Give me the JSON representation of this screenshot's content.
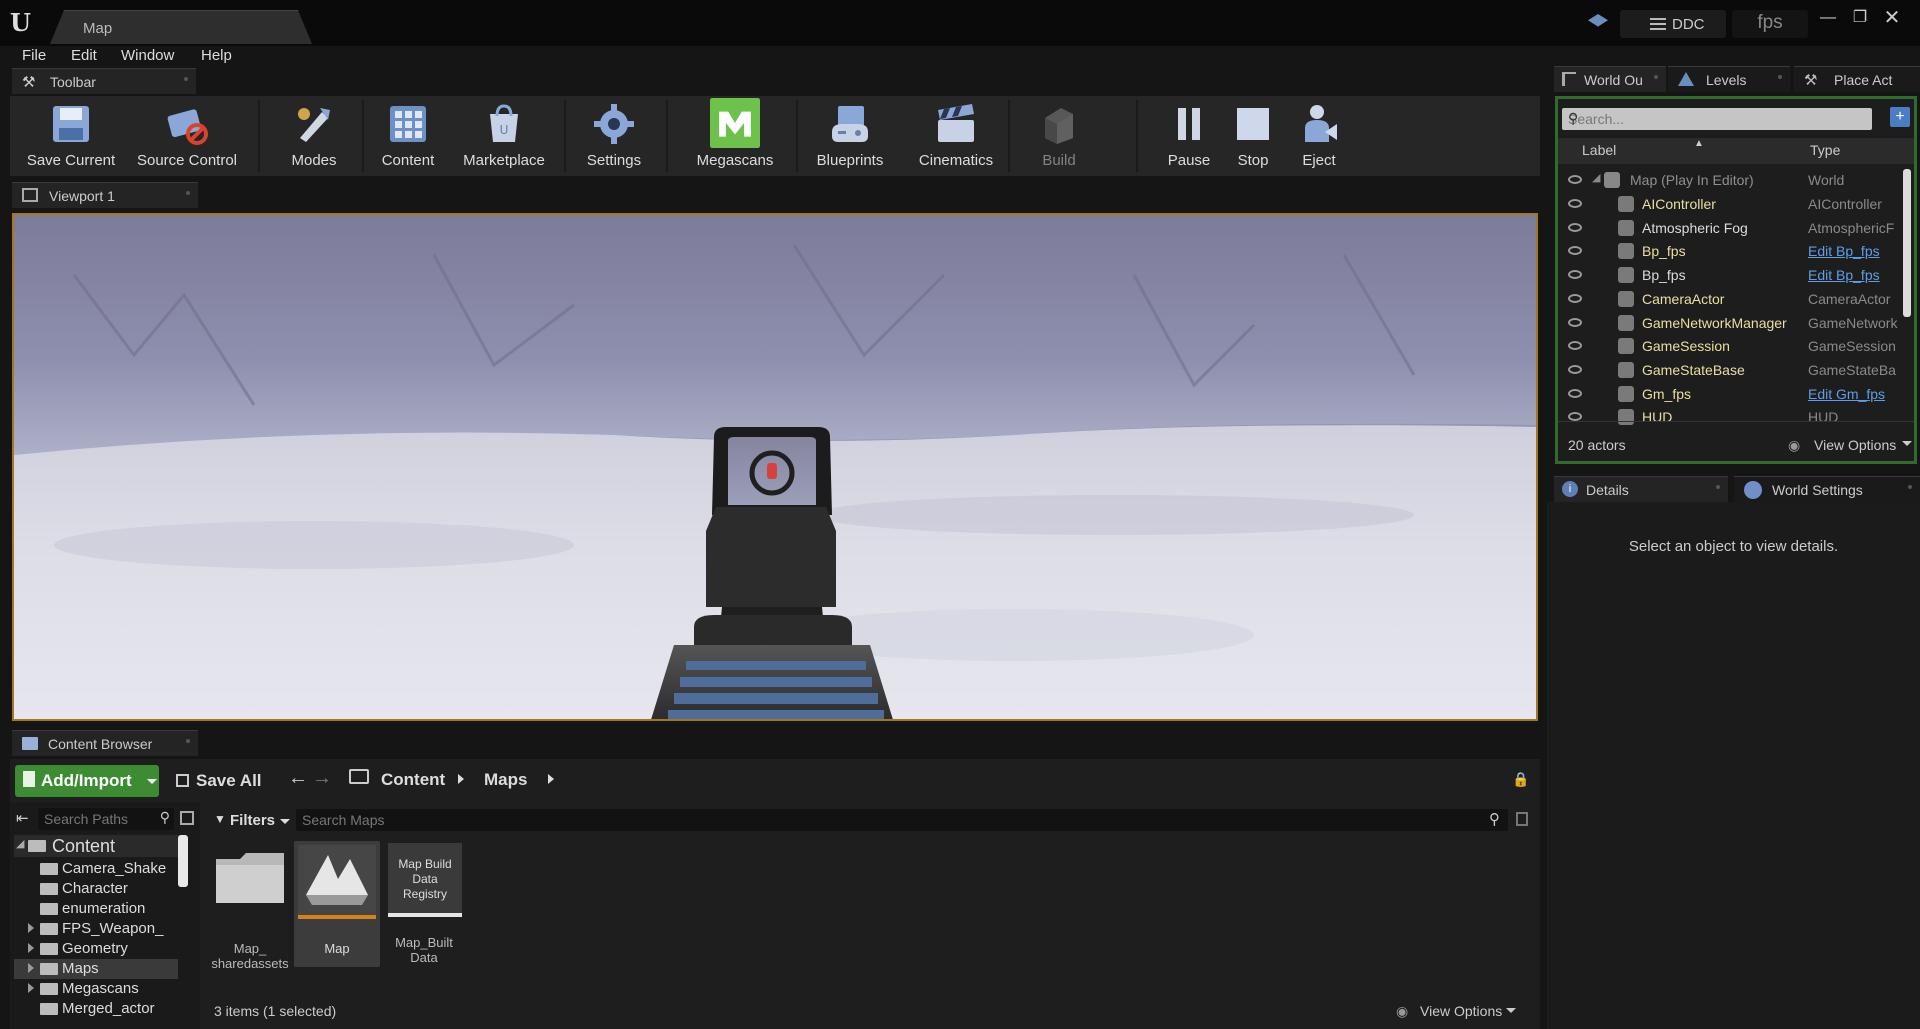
{
  "window": {
    "title": "Map",
    "project": "fps",
    "ddc_label": "DDC"
  },
  "menu": [
    "File",
    "Edit",
    "Window",
    "Help"
  ],
  "toolbar": {
    "tab_label": "Toolbar",
    "buttons": {
      "save_current": "Save Current",
      "source_control": "Source Control",
      "modes": "Modes",
      "content": "Content",
      "marketplace": "Marketplace",
      "settings": "Settings",
      "megascans": "Megascans",
      "blueprints": "Blueprints",
      "cinematics": "Cinematics",
      "build": "Build",
      "pause": "Pause",
      "stop": "Stop",
      "eject": "Eject"
    }
  },
  "viewport": {
    "tab_label": "Viewport 1"
  },
  "outliner": {
    "tabs": [
      "World Ou",
      "Levels",
      "Place Act"
    ],
    "search_placeholder": "Search...",
    "columns": {
      "label": "Label",
      "type": "Type"
    },
    "root": {
      "name": "Map (Play In Editor)",
      "type": "World"
    },
    "rows": [
      {
        "name": "AIController",
        "type": "AIController",
        "link": false
      },
      {
        "name": "Atmospheric Fog",
        "type": "AtmosphericF",
        "link": false
      },
      {
        "name": "Bp_fps",
        "type": "Edit Bp_fps",
        "link": true
      },
      {
        "name": "Bp_fps",
        "type": "Edit Bp_fps",
        "link": true
      },
      {
        "name": "CameraActor",
        "type": "CameraActor",
        "link": false
      },
      {
        "name": "GameNetworkManager",
        "type": "GameNetwork",
        "link": false
      },
      {
        "name": "GameSession",
        "type": "GameSession",
        "link": false
      },
      {
        "name": "GameStateBase",
        "type": "GameStateBa",
        "link": false
      },
      {
        "name": "Gm_fps",
        "type": "Edit Gm_fps",
        "link": true
      },
      {
        "name": "HUD",
        "type": "HUD",
        "link": false
      }
    ],
    "actor_count": "20 actors",
    "view_options": "View Options"
  },
  "details": {
    "tabs": [
      "Details",
      "World Settings"
    ],
    "empty_message": "Select an object to view details."
  },
  "content_browser": {
    "tab_label": "Content Browser",
    "add_import": "Add/Import",
    "save_all": "Save All",
    "breadcrumbs": [
      "Content",
      "Maps"
    ],
    "search_paths_placeholder": "Search Paths",
    "filters_label": "Filters",
    "search_maps_placeholder": "Search Maps",
    "tree": {
      "root": "Content",
      "items": [
        "Camera_Shake",
        "Character",
        "enumeration",
        "FPS_Weapon_",
        "Geometry",
        "Maps",
        "Megascans",
        "Merged_actor"
      ]
    },
    "assets": [
      {
        "label": "Map_\nsharedassets"
      },
      {
        "label": "Map"
      },
      {
        "label": "Map_Built\nData",
        "thumb_text": "Map Build\nData\nRegistry"
      }
    ],
    "status": "3 items (1 selected)",
    "view_options": "View Options"
  },
  "colors": {
    "accent_orange": "#a67722",
    "outliner_border": "#2f6b2a",
    "add_import_green": "#3d8c34",
    "megascans_green": "#6cc24a",
    "link_blue": "#5e9ee6",
    "actor_name": "#eadfa0"
  }
}
